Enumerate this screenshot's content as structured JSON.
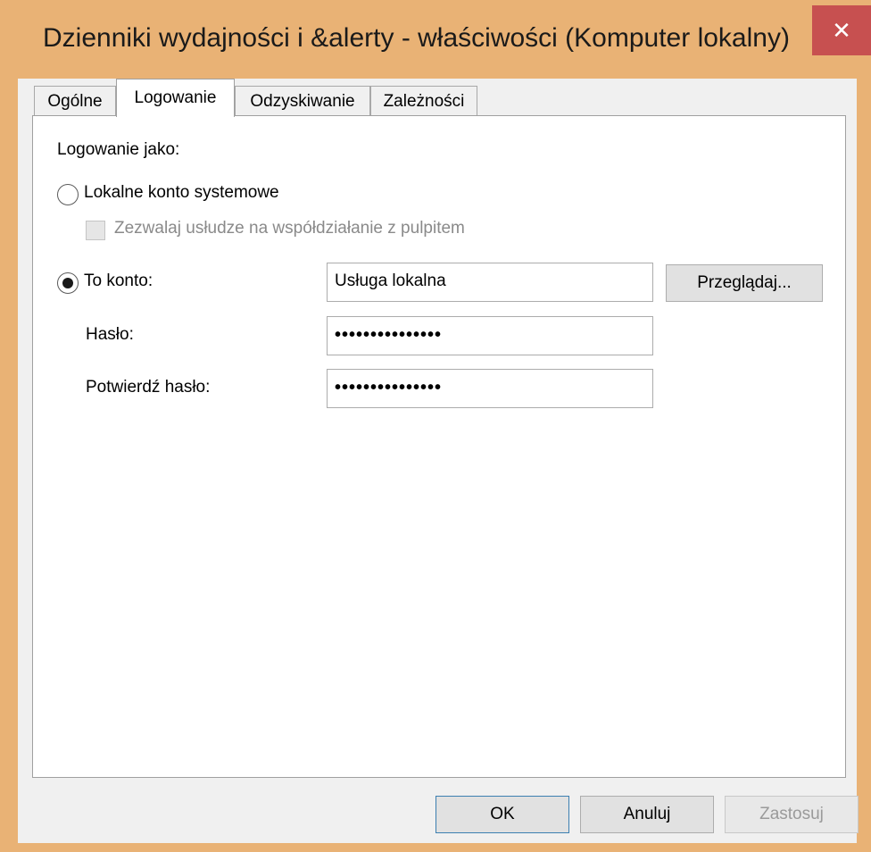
{
  "window": {
    "title": "Dzienniki wydajności i &alerty - właściwości (Komputer lokalny)",
    "close_glyph": "✕"
  },
  "tabs": [
    {
      "label": "Ogólne",
      "active": false
    },
    {
      "label": "Logowanie",
      "active": true
    },
    {
      "label": "Odzyskiwanie",
      "active": false
    },
    {
      "label": "Zależności",
      "active": false
    }
  ],
  "logon": {
    "heading": "Logowanie jako:",
    "local_system": {
      "label": "Lokalne konto systemowe",
      "selected": false
    },
    "allow_desktop": {
      "label": "Zezwalaj usłudze na współdziałanie z pulpitem",
      "checked": false,
      "enabled": false
    },
    "this_account": {
      "label": "To konto:",
      "selected": true,
      "value": "Usługa lokalna"
    },
    "browse_label": "Przeglądaj...",
    "password": {
      "label": "Hasło:",
      "value": "•••••••••••••••"
    },
    "confirm_password": {
      "label": "Potwierdź hasło:",
      "value": "•••••••••••••••"
    }
  },
  "footer": {
    "ok_label": "OK",
    "cancel_label": "Anuluj",
    "apply_label": "Zastosuj"
  },
  "colors": {
    "frame_accent": "#e9b275",
    "close_button": "#c75050"
  }
}
